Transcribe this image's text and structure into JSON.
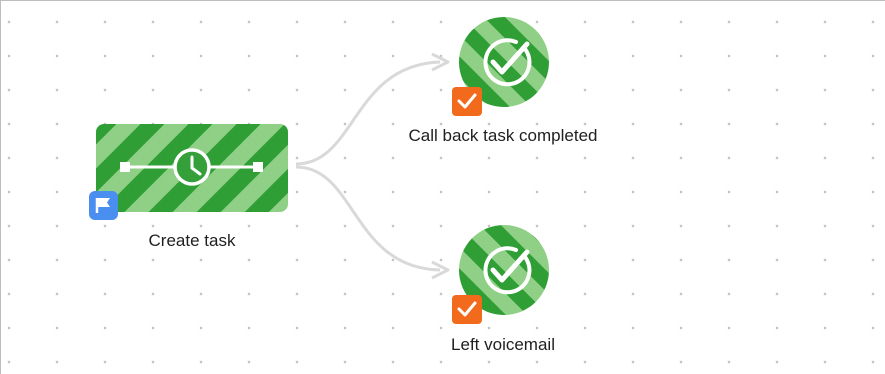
{
  "workflow": {
    "nodes": [
      {
        "id": "create-task",
        "label": "Create task",
        "kind": "action",
        "icon": "clock-icon",
        "badge": "flag-icon",
        "badge_color": "#4a8ef0"
      },
      {
        "id": "call-back",
        "label": "Call back task completed",
        "kind": "outcome",
        "icon": "check-circle-icon",
        "badge": "checkbox-icon",
        "badge_color": "#f26b1d"
      },
      {
        "id": "voicemail",
        "label": "Left voicemail",
        "kind": "outcome",
        "icon": "check-circle-icon",
        "badge": "checkbox-icon",
        "badge_color": "#f26b1d"
      }
    ],
    "edges": [
      {
        "from": "create-task",
        "to": "call-back"
      },
      {
        "from": "create-task",
        "to": "voicemail"
      }
    ]
  },
  "colors": {
    "node_green_dark": "#2f9e35",
    "node_green_light": "#8fcf86",
    "connector": "#d9d9d9",
    "dot_grid": "#c4c4c4"
  }
}
